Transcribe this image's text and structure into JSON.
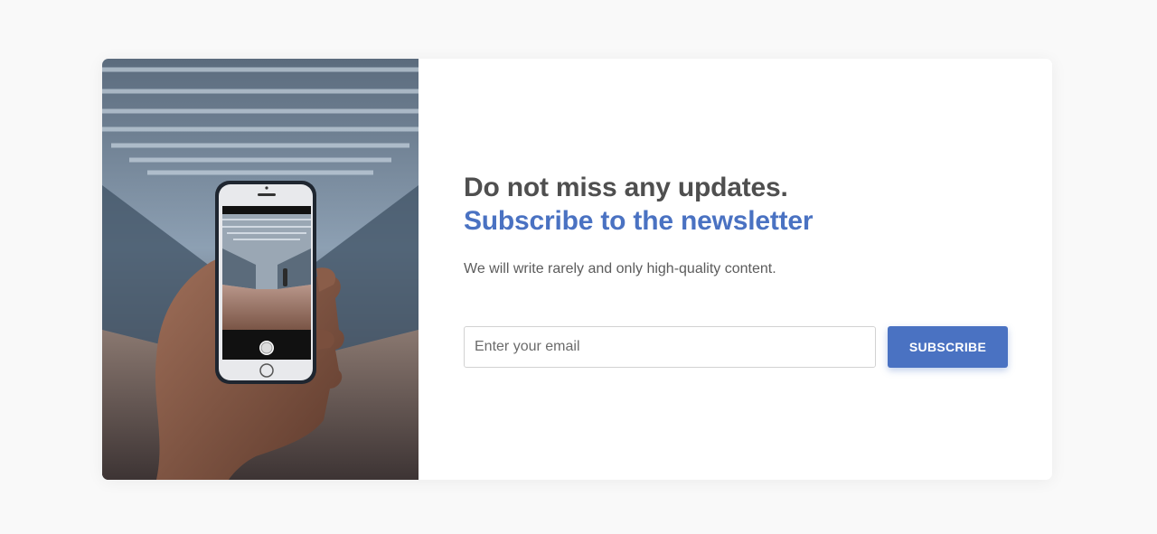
{
  "newsletter": {
    "image_alt": "hand holding smartphone photographing corridor",
    "headline_line1": "Do not miss any updates.",
    "headline_line2": "Subscribe to the newsletter",
    "description": "We will write rarely and only high-quality content.",
    "email_placeholder": "Enter your email",
    "email_value": "",
    "subscribe_label": "SUBSCRIBE"
  },
  "colors": {
    "background": "#f9f9f9",
    "card": "#ffffff",
    "accent": "#4a72c2",
    "heading": "#4f4f4f",
    "body_text": "#5c5c5c"
  }
}
